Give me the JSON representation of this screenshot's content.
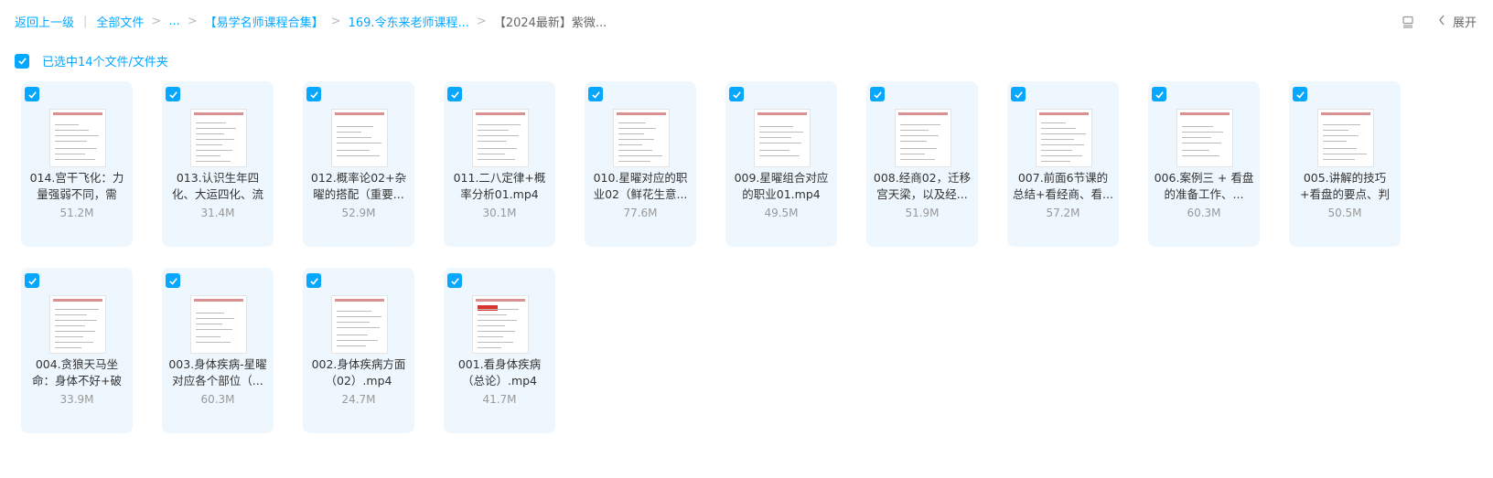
{
  "breadcrumb": {
    "back": "返回上一级",
    "all_files": "全部文件",
    "ellipsis": "...",
    "level1": "【易学名师课程合集】",
    "level2": "169.令东来老师课程...",
    "current": "【2024最新】紫微..."
  },
  "toolbar": {
    "list_icon": "list-view-icon",
    "expand_label": "展开"
  },
  "selection": {
    "label": "已选中14个文件/文件夹",
    "checked": true
  },
  "colors": {
    "accent": "#06a7ff",
    "card_bg": "#eef7fe"
  },
  "files": [
    {
      "name": "014.宫干飞化：力量强弱不同，需",
      "size": "51.2M",
      "checked": true
    },
    {
      "name": "013.认识生年四化、大运四化、流",
      "size": "31.4M",
      "checked": true
    },
    {
      "name": "012.概率论02+杂曜的搭配（重要...",
      "size": "52.9M",
      "checked": true
    },
    {
      "name": "011.二八定律+概率分析01.mp4",
      "size": "30.1M",
      "checked": true
    },
    {
      "name": "010.星曜对应的职业02（鲜花生意...",
      "size": "77.6M",
      "checked": true
    },
    {
      "name": "009.星曜组合对应的职业01.mp4",
      "size": "49.5M",
      "checked": true
    },
    {
      "name": "008.经商02，迁移宫天梁，以及经...",
      "size": "51.9M",
      "checked": true
    },
    {
      "name": "007.前面6节课的总结+看经商、看...",
      "size": "57.2M",
      "checked": true
    },
    {
      "name": "006.案例三 + 看盘的准备工作、...",
      "size": "60.3M",
      "checked": true
    },
    {
      "name": "005.讲解的技巧+看盘的要点、判",
      "size": "50.5M",
      "checked": true
    },
    {
      "name": "004.贪狼天马坐命：身体不好+破",
      "size": "33.9M",
      "checked": true
    },
    {
      "name": "003.身体疾病-星曜对应各个部位（...",
      "size": "60.3M",
      "checked": true
    },
    {
      "name": "002.身体疾病方面（02）.mp4",
      "size": "24.7M",
      "checked": true
    },
    {
      "name": "001.看身体疾病（总论）.mp4",
      "size": "41.7M",
      "checked": true
    }
  ]
}
